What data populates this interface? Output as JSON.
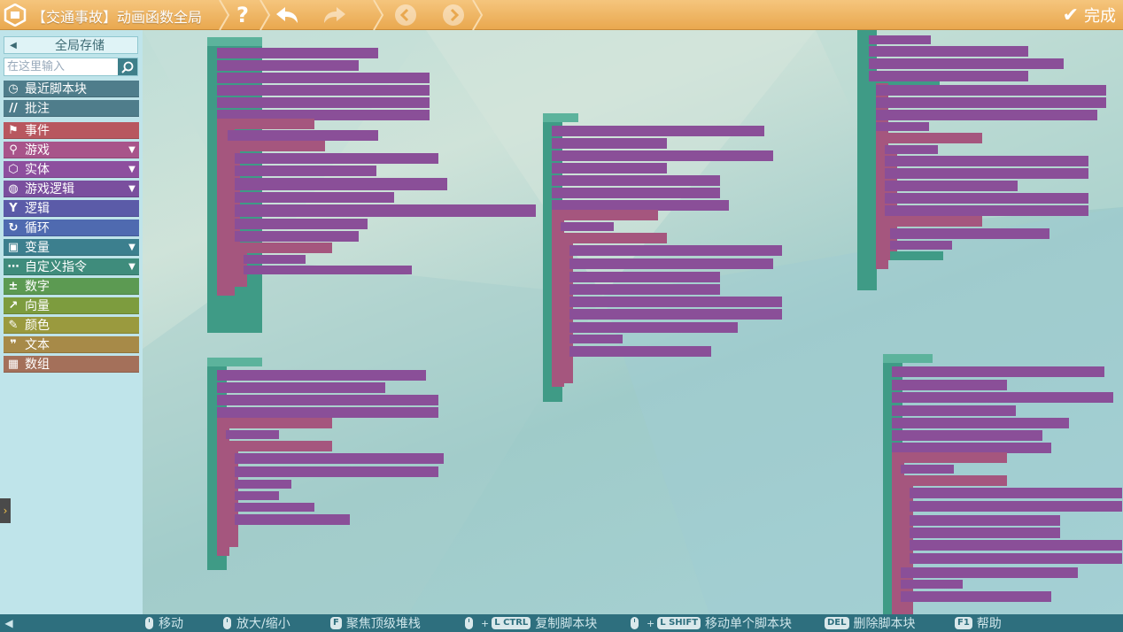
{
  "topbar": {
    "title": "【交通事故】动画函数全局",
    "help_label": "?",
    "done_label": "完成"
  },
  "palette": {
    "global_store_label": "全局存储",
    "search_placeholder": "在这里输入",
    "categories": [
      {
        "label": "最近脚本块",
        "icon": "clock-icon",
        "color": "#4f7d8b",
        "expandable": false
      },
      {
        "label": "批注",
        "icon": "comment-icon",
        "color": "#4f7d8b",
        "expandable": false
      },
      {
        "label": "事件",
        "icon": "flag-icon",
        "color": "#b8575f",
        "expandable": false
      },
      {
        "label": "游戏",
        "icon": "joystick-icon",
        "color": "#a8548a",
        "expandable": true
      },
      {
        "label": "实体",
        "icon": "cube-icon",
        "color": "#8d4f9e",
        "expandable": true
      },
      {
        "label": "游戏逻辑",
        "icon": "bulb-icon",
        "color": "#7a4f9e",
        "expandable": true
      },
      {
        "label": "逻辑",
        "icon": "branch-icon",
        "color": "#5b5ba8",
        "expandable": false
      },
      {
        "label": "循环",
        "icon": "loop-icon",
        "color": "#4f6ab0",
        "expandable": false
      },
      {
        "label": "变量",
        "icon": "variable-icon",
        "color": "#3c7f8e",
        "expandable": true
      },
      {
        "label": "自定义指令",
        "icon": "dots-icon",
        "color": "#3f8c7c",
        "expandable": true
      },
      {
        "label": "数字",
        "icon": "number-icon",
        "color": "#5c9a52",
        "expandable": false
      },
      {
        "label": "向量",
        "icon": "vector-icon",
        "color": "#7d9c3e",
        "expandable": false
      },
      {
        "label": "颜色",
        "icon": "pen-icon",
        "color": "#9a9a3e",
        "expandable": false
      },
      {
        "label": "文本",
        "icon": "quote-icon",
        "color": "#a78a48",
        "expandable": false
      },
      {
        "label": "数组",
        "icon": "grid-icon",
        "color": "#a4705a",
        "expandable": false
      }
    ]
  },
  "bottombar": {
    "hints": [
      {
        "key": "",
        "label": "移动",
        "kind": "mouse"
      },
      {
        "key": "",
        "label": "放大/缩小",
        "kind": "mouse"
      },
      {
        "key": "F",
        "label": "聚焦顶级堆栈",
        "kind": "key"
      },
      {
        "key": "L CTRL",
        "label": "复制脚本块",
        "kind": "mouse-key"
      },
      {
        "key": "L SHIFT",
        "label": "移动单个脚本块",
        "kind": "mouse-key"
      },
      {
        "key": "DEL",
        "label": "删除脚本块",
        "kind": "key"
      },
      {
        "key": "F1",
        "label": "帮助",
        "kind": "key"
      }
    ]
  },
  "colors": {
    "topbar": "#eeb15f",
    "palette_bg": "#bfe4ea",
    "bottombar": "#2e6f7e",
    "block_function": "#3f9b86",
    "block_loop": "#a5567e",
    "block_action": "#8a4f98",
    "block_slot": "#4b4b4b"
  }
}
